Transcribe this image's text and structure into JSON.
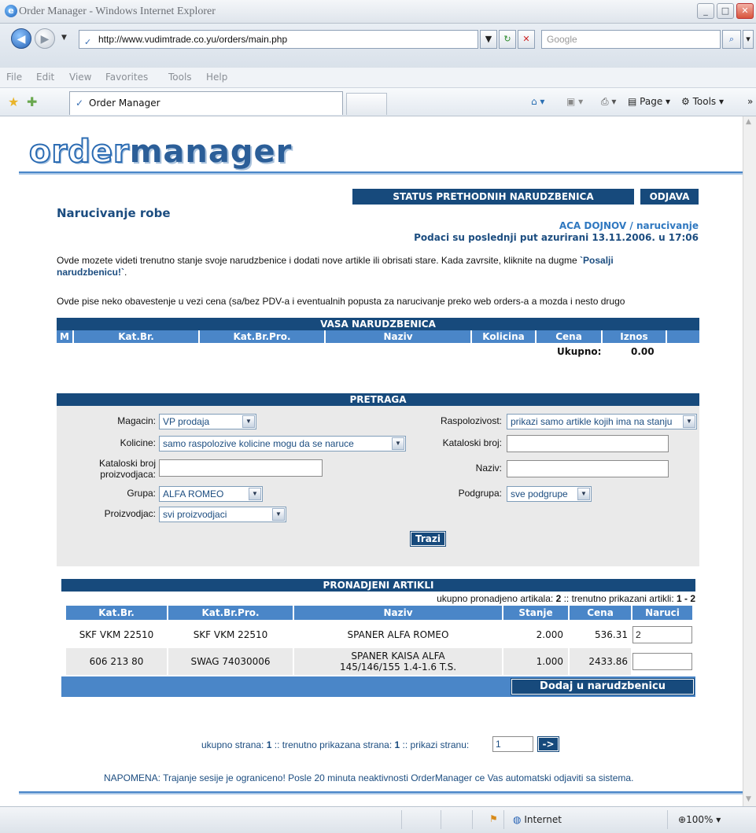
{
  "browser": {
    "window_title": "Order Manager - Windows Internet Explorer",
    "url": "http://www.vudimtrade.co.yu/orders/main.php",
    "search_placeholder": "Google",
    "menu": [
      "File",
      "Edit",
      "View",
      "Favorites",
      "Tools",
      "Help"
    ],
    "tab_title": "Order Manager",
    "cmd_page": "Page",
    "cmd_tools": "Tools",
    "status_zone": "Internet",
    "zoom": "100%"
  },
  "page": {
    "logo_part1": "order",
    "logo_part2": "manager",
    "nav_status": "STATUS PRETHODNIH NARUDZBENICA",
    "nav_logout": "ODJAVA",
    "title": "Narucivanje robe",
    "user_line": "ACA DOJNOV / narucivanje",
    "updated_line": "Podaci su poslednji put azurirani 13.11.2006. u 17:06",
    "intro_text": "Ovde mozete videti trenutno stanje svoje narudzbenice i dodati nove artikle ili obrisati stare. Kada zavrsite, kliknite na dugme ",
    "intro_bold": "`Posalji narudzbenicu!`",
    "intro_end": ".",
    "notice": "Ovde pise neko obavestenje u vezi cena (sa/bez PDV-a i eventualnih popusta za narucivanje preko web orders-a a mozda i nesto drugo",
    "order": {
      "heading": "VASA NARUDZBENICA",
      "columns": [
        "M",
        "Kat.Br.",
        "Kat.Br.Pro.",
        "Naziv",
        "Kolicina",
        "Cena",
        "Iznos"
      ],
      "total_label": "Ukupno:",
      "total_value": "0.00"
    },
    "search": {
      "heading": "PRETRAGA",
      "magacin_label": "Magacin:",
      "magacin_value": "VP prodaja",
      "kolicine_label": "Kolicine:",
      "kolicine_value": "samo raspolozive kolicine mogu da se naruce",
      "katbr_pro_label_1": "Kataloski broj",
      "katbr_pro_label_2": "proizvodjaca:",
      "grupa_label": "Grupa:",
      "grupa_value": "ALFA ROMEO",
      "proizvodjac_label": "Proizvodjac:",
      "proizvodjac_value": "svi proizvodjaci",
      "raspolozivost_label": "Raspolozivost:",
      "raspolozivost_value": "prikazi samo artikle kojih ima na stanju",
      "katbr_label": "Kataloski broj:",
      "naziv_label": "Naziv:",
      "podgrupa_label": "Podgrupa:",
      "podgrupa_value": "sve podgrupe",
      "search_button": "Trazi"
    },
    "results": {
      "heading": "PRONADJENI ARTIKLI",
      "summary_prefix": "ukupno pronadjeno artikala: ",
      "summary_count": "2",
      "summary_mid": " :: trenutno prikazani artikli: ",
      "summary_range": "1 - 2",
      "columns": [
        "Kat.Br.",
        "Kat.Br.Pro.",
        "Naziv",
        "Stanje",
        "Cena",
        "Naruci"
      ],
      "rows": [
        {
          "katbr": "SKF VKM 22510",
          "katbrpro": "SKF VKM 22510",
          "naziv": "SPANER ALFA ROMEO",
          "stanje": "2.000",
          "cena": "536.31",
          "naruci": "2"
        },
        {
          "katbr": "606 213 80",
          "katbrpro": "SWAG 74030006",
          "naziv": "SPANER KAISA ALFA 145/146/155 1.4-1.6 T.S.",
          "stanje": "1.000",
          "cena": "2433.86",
          "naruci": ""
        }
      ],
      "add_button": "Dodaj u narudzbenicu"
    },
    "paging": {
      "p1": "ukupno strana: ",
      "total": "1",
      "p2": " :: trenutno prikazana strana: ",
      "current": "1",
      "p3": " :: prikazi stranu: ",
      "input_value": "1",
      "go_button": "->"
    },
    "session_note": "NAPOMENA: Trajanje sesije je ograniceno! Posle 20 minuta neaktivnosti OrderManager ce Vas automatski odjaviti sa sistema."
  }
}
